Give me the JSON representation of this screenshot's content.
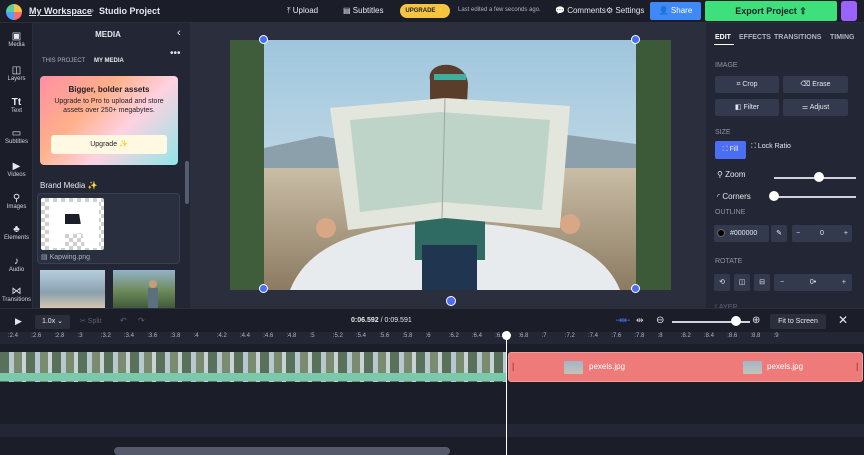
{
  "topbar": {
    "workspace": "My Workspace",
    "crumb_sep": "›",
    "project": "Studio Project",
    "upload": "Upload",
    "subtitles": "Subtitles",
    "upgrade": "UPGRADE ⚡",
    "edited": "Last edited a few seconds ago.",
    "comments": "Comments",
    "settings": "Settings",
    "share": "Share",
    "export": "Export Project",
    "upload_icon": "⤒",
    "subtitles_icon": "▤",
    "comments_icon": "💬",
    "settings_icon": "⚙",
    "share_icon": "👤",
    "export_icon": "⇪"
  },
  "rail": {
    "items": [
      {
        "label": "Media",
        "icon": "▣"
      },
      {
        "label": "Layers",
        "icon": "◫"
      },
      {
        "label": "Text",
        "icon": "Tt"
      },
      {
        "label": "Subtitles",
        "icon": "▭"
      },
      {
        "label": "Videos",
        "icon": "▶"
      },
      {
        "label": "Images",
        "icon": "⚲"
      },
      {
        "label": "Elements",
        "icon": "♣"
      },
      {
        "label": "Audio",
        "icon": "♪"
      },
      {
        "label": "Transitions",
        "icon": "⋈"
      }
    ]
  },
  "media": {
    "title": "MEDIA",
    "close": "‹",
    "more": "•••",
    "tabs": [
      "THIS PROJECT",
      "MY MEDIA"
    ],
    "promo_title": "Bigger, bolder assets",
    "promo_text": "Upgrade to Pro to upload and store assets over 250+ megabytes.",
    "promo_button": "Upgrade ✨",
    "brand_title": "Brand Media ✨",
    "brand_file": "Kapwing.png",
    "file_icon": "▤"
  },
  "props": {
    "tabs": [
      "EDIT",
      "EFFECTS",
      "TRANSITIONS",
      "TIMING"
    ],
    "image_section": "IMAGE",
    "crop": "Crop",
    "erase": "Erase",
    "filter": "Filter",
    "adjust": "Adjust",
    "crop_icon": "⌗",
    "erase_icon": "⌫",
    "filter_icon": "◧",
    "adjust_icon": "⚌",
    "size_section": "SIZE",
    "fill": "Fill",
    "fill_icon": "⛶",
    "lock_ratio": "Lock Ratio",
    "lock_icon": "⛶",
    "zoom": "Zoom",
    "zoom_icon": "⚲",
    "corners": "Corners",
    "corners_icon": "◜",
    "zoom_level": 0.55,
    "corners_level": 0.0,
    "outline_section": "OUTLINE",
    "outline_color": "#000000",
    "eyedropper_icon": "✎",
    "minus": "−",
    "outline_value": "0",
    "plus": "+",
    "rotate_section": "ROTATE",
    "rotate_icons": [
      "⟲",
      "◫",
      "⊟"
    ],
    "rotate_minus": "−",
    "rotate_value": "0•",
    "rotate_plus": "+",
    "layer_section": "LAYER"
  },
  "timeline": {
    "play_icon": "▶",
    "speed": "1.0x ⌄",
    "split": "✂ Split",
    "undo": "↶",
    "redo": "↷",
    "time_current": "0:06.592",
    "time_total": "/ 0:09.591",
    "zoom_out_icon": "⊖",
    "zoom_in_icon": "⊕",
    "fit": "Fit to Screen",
    "close_icon": "✕",
    "zoom_level": 0.82,
    "ticks": [
      ":2.4",
      ":2.6",
      ":2.8",
      ":3",
      ":3.2",
      ":3.4",
      ":3.6",
      ":3.8",
      ":4",
      ":4.2",
      ":4.4",
      ":4.6",
      ":4.8",
      ":5",
      ":5.2",
      ":5.4",
      ":5.6",
      ":5.8",
      ":6",
      ":6.2",
      ":6.4",
      ":6.6",
      ":6.8",
      ":7",
      ":7.2",
      ":7.4",
      ":7.6",
      ":7.8",
      ":8",
      ":8.2",
      ":8.4",
      ":8.6",
      ":8.8",
      ":9"
    ],
    "img_label_1": "pexels.jpg",
    "img_label_2": "pexels.jpg",
    "trim_left": "|",
    "trim_right": "|"
  },
  "colors": {
    "accent": "#4c6ef5",
    "export": "#3ee07b",
    "image_clip": "#ee7a7a",
    "upgrade": "#f5c542"
  }
}
